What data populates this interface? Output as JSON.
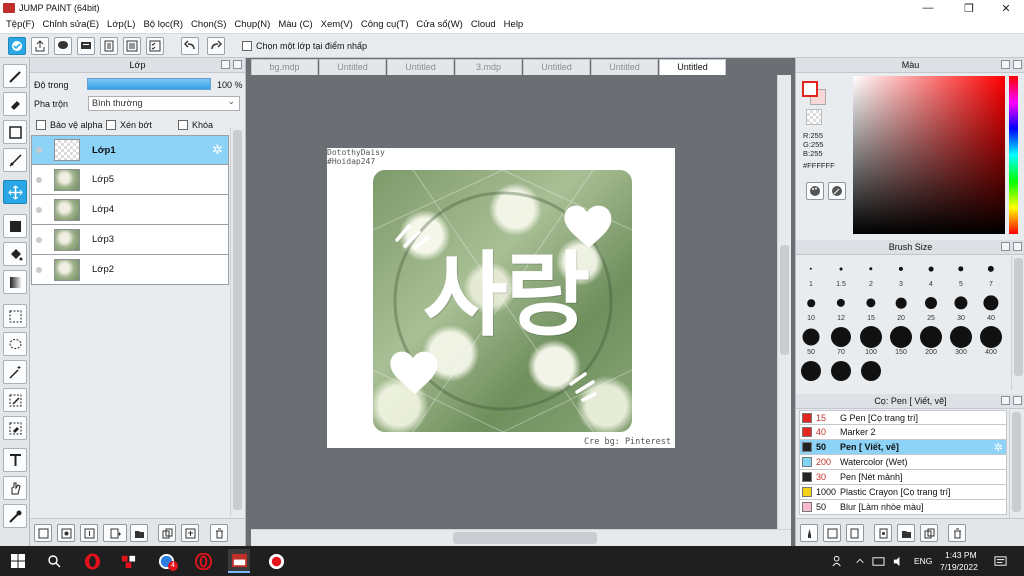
{
  "window": {
    "title": "JUMP PAINT (64bit)",
    "minimize": "—",
    "restore": "❐",
    "close": "✕"
  },
  "menu": [
    "Tệp(F)",
    "Chỉnh sửa(E)",
    "Lớp(L)",
    "Bộ lọc(R)",
    "Chọn(S)",
    "Chụp(N)",
    "Màu (C)",
    "Xem(V)",
    "Công cụ(T)",
    "Cửa sổ(W)",
    "Cloud",
    "Help"
  ],
  "toolbar": {
    "checkbox_label": "Chọn một lớp tại điểm nhấp"
  },
  "layer_panel": {
    "title": "Lớp",
    "opacity_label": "Độ trong",
    "opacity_value": "100 %",
    "opacity_fraction": 1.0,
    "blend_label": "Pha trộn",
    "blend_value": "Bình thường",
    "protect_alpha": "Bảo vệ alpha",
    "clipping": "Xén bớt",
    "lock": "Khóa",
    "layers": [
      {
        "name": "Lớp1",
        "selected": true
      },
      {
        "name": "Lớp5",
        "selected": false
      },
      {
        "name": "Lớp4",
        "selected": false
      },
      {
        "name": "Lớp3",
        "selected": false
      },
      {
        "name": "Lớp2",
        "selected": false
      }
    ]
  },
  "tabs": [
    {
      "label": "bg.mdp",
      "active": false
    },
    {
      "label": "Untitled",
      "active": false
    },
    {
      "label": "Untitled",
      "active": false
    },
    {
      "label": "3.mdp",
      "active": false
    },
    {
      "label": "Untitled",
      "active": false
    },
    {
      "label": "Untitled",
      "active": false
    },
    {
      "label": "Untitled",
      "active": true
    }
  ],
  "artwork": {
    "watermark_line1": "DotothyDaisy",
    "watermark_line2": "#Hoidap247",
    "main_text": "사랑",
    "credit": "Cre bg: Pinterest"
  },
  "color_panel": {
    "title": "Màu",
    "r": "R:255",
    "g": "G:255",
    "b": "B:255",
    "hex": "#FFFFFF",
    "accent": "#e0261f"
  },
  "brush_panel": {
    "title": "Brush Size",
    "sizes": [
      "1",
      "1.5",
      "2",
      "3",
      "4",
      "5",
      "7",
      "10",
      "12",
      "15",
      "20",
      "25",
      "30",
      "40",
      "50",
      "70",
      "100",
      "150",
      "200",
      "300",
      "400",
      "",
      "",
      ""
    ]
  },
  "pen_panel": {
    "title": "Cọ: Pen [ Viết, vẽ]",
    "pens": [
      {
        "size": "15",
        "name": "G Pen [Cọ trang trí]",
        "color": "#e0261f"
      },
      {
        "size": "40",
        "name": "Marker 2",
        "color": "#e0261f"
      },
      {
        "size": "50",
        "name": "Pen [ Viết, vẽ]",
        "color": "#222222",
        "selected": true
      },
      {
        "size": "200",
        "name": "Watercolor (Wet)",
        "color": "#7fd6f5"
      },
      {
        "size": "30",
        "name": "Pen [Nét mảnh]",
        "color": "#222222"
      },
      {
        "size": "1000",
        "name": "Plastic Crayon [Cọ trang trí]",
        "color": "#f3d31a"
      },
      {
        "size": "50",
        "name": "Blur [Làm nhòe màu]",
        "color": "#f7b8d0"
      }
    ]
  },
  "taskbar": {
    "language": "ENG",
    "time": "1:43 PM",
    "date": "7/19/2022",
    "badge": "4"
  }
}
